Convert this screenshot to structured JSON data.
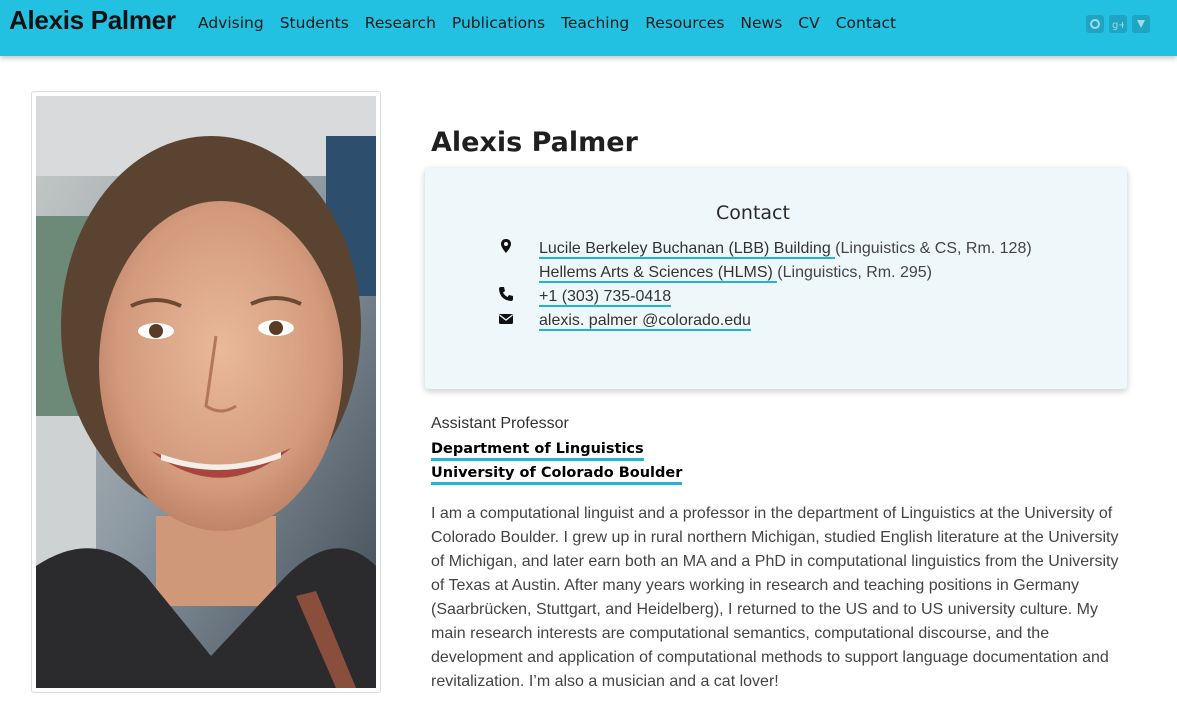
{
  "site": {
    "title": "Alexis Palmer"
  },
  "nav": {
    "items": [
      "Advising",
      "Students",
      "Research",
      "Publications",
      "Teaching",
      "Resources",
      "News",
      "CV",
      "Contact"
    ]
  },
  "social": {
    "icons": [
      "github-icon",
      "google-plus-icon",
      "gravatar-icon"
    ]
  },
  "profile": {
    "name": "Alexis Palmer",
    "photo_alt": "portrait photo"
  },
  "contact": {
    "title": "Contact",
    "building1_link": "Lucile Berkeley Buchanan (LBB) Building ",
    "building1_note": "(Linguistics & CS, Rm. 128)",
    "building2_link": "Hellems Arts & Sciences (HLMS) ",
    "building2_note": "(Linguistics, Rm. 295)",
    "phone": "+1 (303) 735-0418",
    "email": "alexis. palmer @colorado.edu"
  },
  "affiliation": {
    "role": "Assistant Professor",
    "department": "Department of Linguistics",
    "university": "University of Colorado Boulder"
  },
  "bio": {
    "text": "I am a computational linguist and a professor in the department of Linguistics at the University of Colorado Boulder. I grew up in rural northern Michigan, studied English literature at the University of Michigan, and later earn both an MA and a PhD in computational linguistics from the University of Texas at Austin. After many years working in research and teaching positions in Germany (Saarbrücken, Stuttgart, and Heidelberg), I returned to the US and to US university culture. My main research interests are computational semantics, computational discourse, and the development and application of computational methods to support language documentation and revitalization. I’m also a musician and a cat lover!"
  },
  "colors": {
    "topbar": "#22c1e2",
    "link_underline": "#22b4d6",
    "card_bg": "#eef8fb"
  }
}
